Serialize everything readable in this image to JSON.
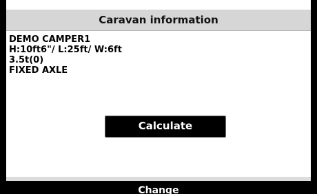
{
  "header": {
    "title": "Caravan information"
  },
  "caravan": {
    "lines": [
      "DEMO CAMPER1",
      "H:10ft6\"/ L:25ft/ W:6ft",
      "3.5t(0)",
      "FIXED AXLE"
    ]
  },
  "actions": {
    "calculate_label": "Calculate",
    "change_label": "Change"
  },
  "colors": {
    "title_bar_bg": "#d6d6d6",
    "button_bg": "#000000",
    "button_text": "#ffffff",
    "frame": "#000000"
  }
}
